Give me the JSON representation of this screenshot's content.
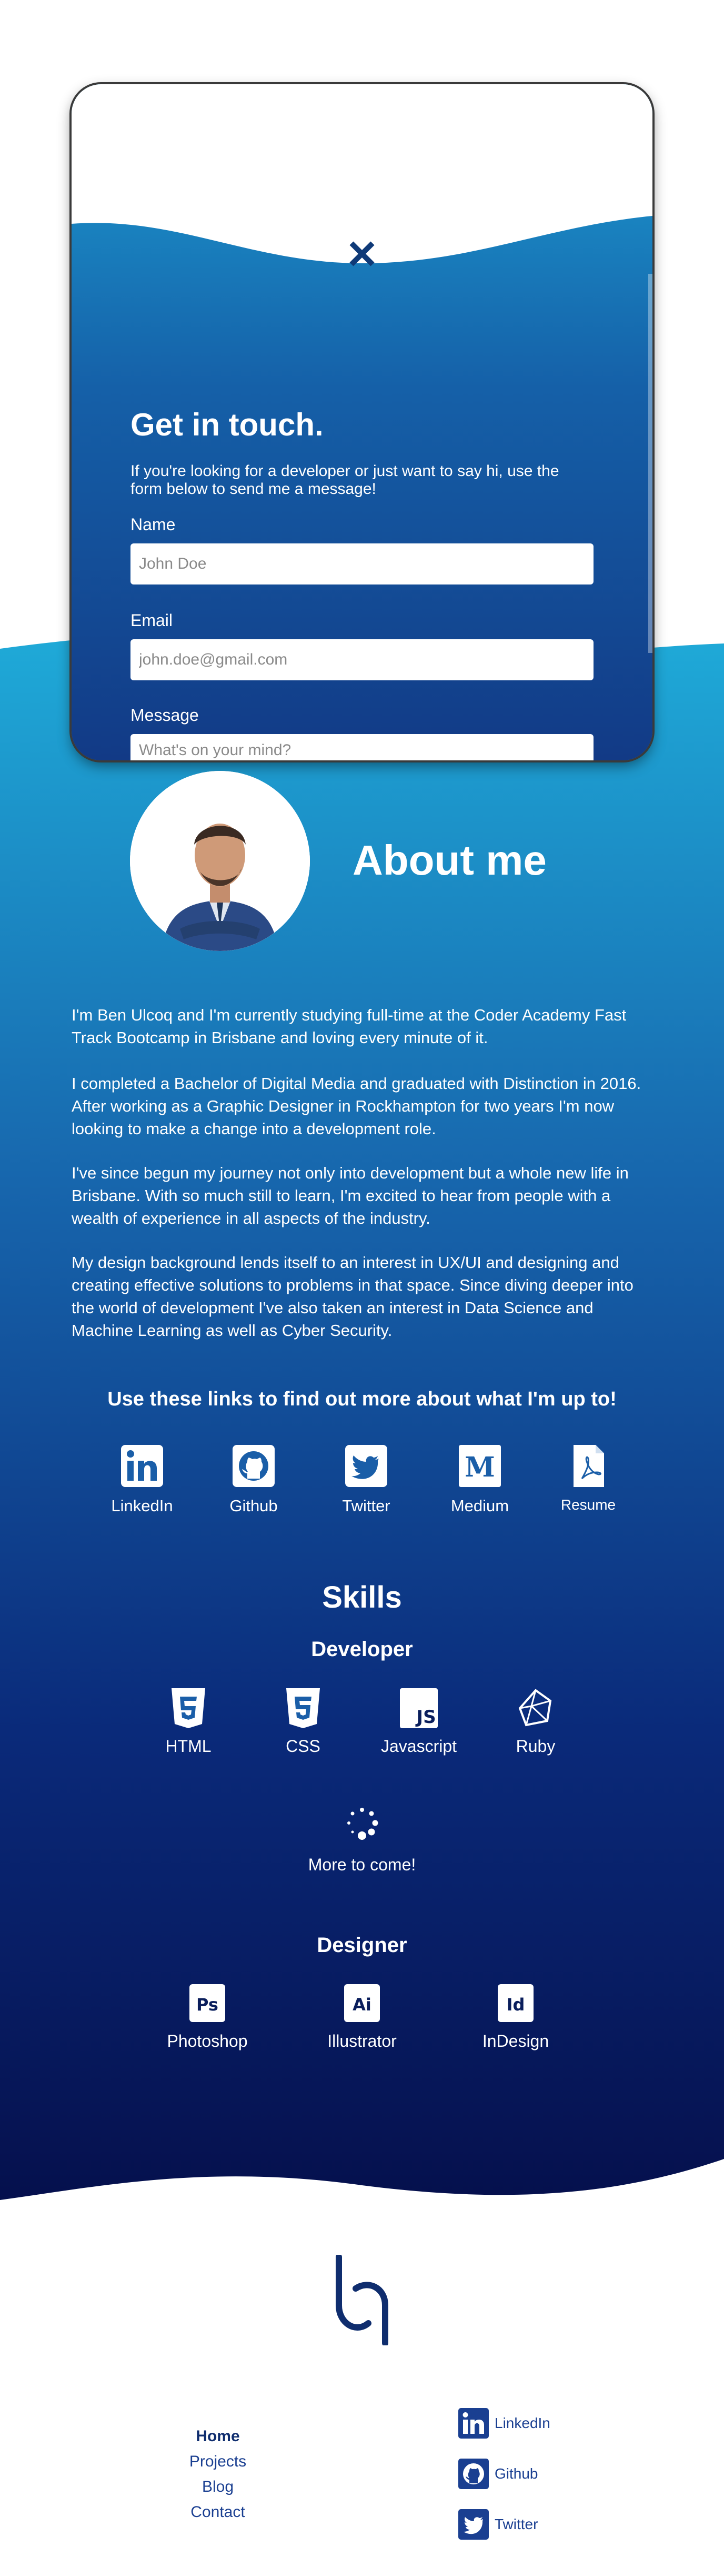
{
  "contact": {
    "title": "Get in touch.",
    "subtitle": "If you're looking for a developer or just want to say hi, use the form below to send me a message!",
    "name_label": "Name",
    "name_placeholder": "John Doe",
    "email_label": "Email",
    "email_placeholder": "john.doe@gmail.com",
    "message_label": "Message",
    "message_placeholder": "What's on your mind?",
    "close_icon": "close-icon"
  },
  "about": {
    "title": "About me",
    "paragraphs": [
      "I'm Ben Ulcoq and I'm currently studying full-time at the Coder Academy Fast Track Bootcamp in Brisbane and loving every minute of it.",
      "I completed a Bachelor of Digital Media and graduated with Distinction in 2016. After working as a Graphic Designer in Rockhampton for two years I'm now looking to make a change into a development role.",
      "I've since begun my journey not only into development but a whole new life in Brisbane. With so much still to learn, I'm excited to hear from people with a wealth of experience in all aspects of the industry.",
      "My design background lends itself to an interest in UX/UI and designing and creating effective solutions to problems in that space. Since diving deeper into the world of development I've also taken an interest in Data Science and Machine Learning as well as Cyber Security."
    ],
    "links_title": "Use these links to find out more about what I'm up to!",
    "links": [
      {
        "label": "LinkedIn",
        "icon": "linkedin-icon"
      },
      {
        "label": "Github",
        "icon": "github-icon"
      },
      {
        "label": "Twitter",
        "icon": "twitter-icon"
      },
      {
        "label": "Medium",
        "icon": "medium-icon"
      },
      {
        "label": "Resume",
        "icon": "pdf-icon"
      }
    ]
  },
  "skills": {
    "title": "Skills",
    "developer_title": "Developer",
    "developer": [
      {
        "label": "HTML",
        "icon": "html5-icon"
      },
      {
        "label": "CSS",
        "icon": "css3-icon"
      },
      {
        "label": "Javascript",
        "icon": "js-icon",
        "badge": "JS"
      },
      {
        "label": "Ruby",
        "icon": "ruby-icon"
      }
    ],
    "more_label": "More to come!",
    "designer_title": "Designer",
    "designer": [
      {
        "label": "Photoshop",
        "icon": "photoshop-icon",
        "badge": "Ps"
      },
      {
        "label": "Illustrator",
        "icon": "illustrator-icon",
        "badge": "Ai"
      },
      {
        "label": "InDesign",
        "icon": "indesign-icon",
        "badge": "Id"
      }
    ]
  },
  "footer": {
    "logo_icon": "bq-logo-icon",
    "nav": [
      "Home",
      "Projects",
      "Blog",
      "Contact"
    ],
    "social": [
      "LinkedIn",
      "Github",
      "Twitter"
    ]
  },
  "colors": {
    "primary_light": "#1d9ed2",
    "primary_dark": "#05104d",
    "footer_text": "#1a3f91",
    "white": "#ffffff"
  }
}
